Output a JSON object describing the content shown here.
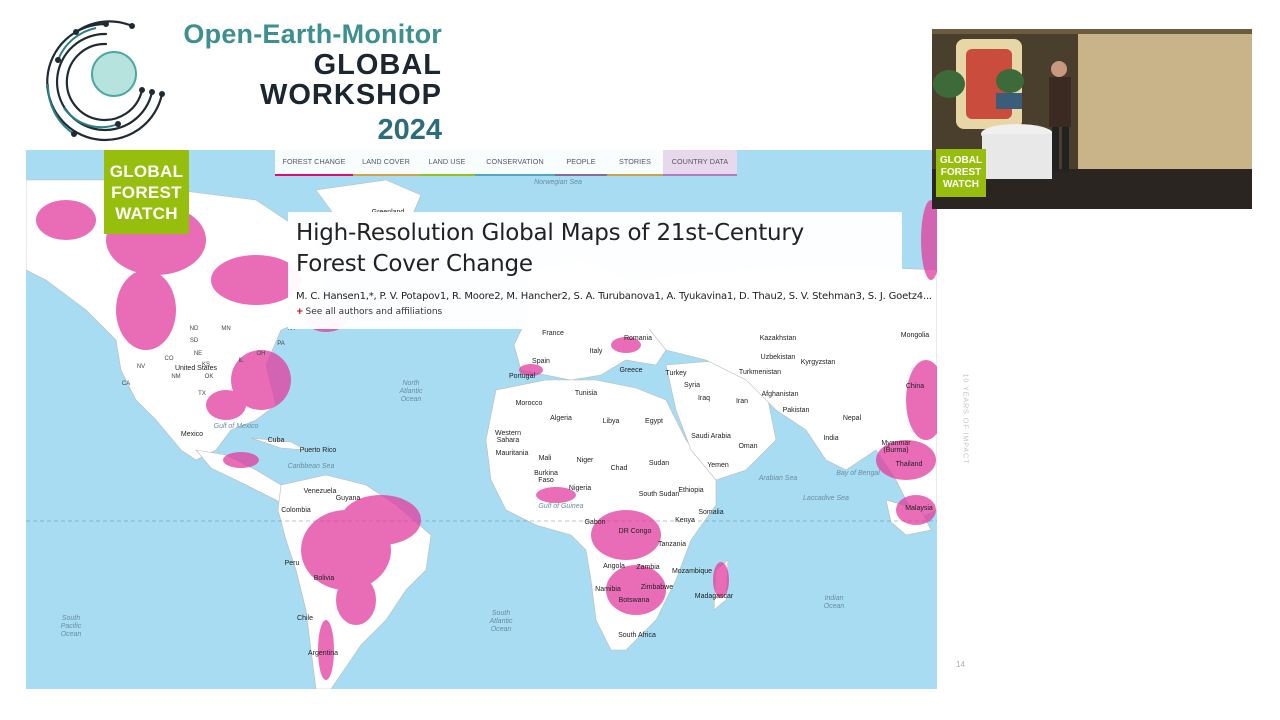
{
  "branding": {
    "line1": "Open-Earth-Monitor",
    "line2": "GLOBAL",
    "line3": "WORKSHOP",
    "year": "2024",
    "color_teal": "#3e8f8f",
    "color_dark": "#1b2630"
  },
  "slide": {
    "gfw_logo": [
      "GLOBAL",
      "FOREST",
      "WATCH"
    ],
    "nav": [
      "FOREST CHANGE",
      "LAND COVER",
      "LAND USE",
      "CONSERVATION",
      "PEOPLE",
      "STORIES",
      "COUNTRY DATA"
    ],
    "nav_colors": [
      "#e2097a",
      "#d1a545",
      "#98c21b",
      "#55a6c0",
      "#8a6a9a",
      "#c9a34a",
      "#b07bbf"
    ],
    "paper": {
      "title": "High-Resolution Global Maps of 21st-Century Forest Cover Change",
      "authors": "M. C. Hansen1,*, P. V. Potapov1, R. Moore2, M. Hancher2, S. A. Turubanova1, A. Tyukavina1, D. Thau2, S. V. Stehman3, S. J. Goetz4...",
      "affiliations": "See all authors and affiliations"
    },
    "map": {
      "ocean_color": "#a7dcf2",
      "land_color": "#ffffff",
      "forest_loss_color": "#e23c9f",
      "oceans": [
        "North Atlantic Ocean",
        "South Atlantic Ocean",
        "South Pacific Ocean",
        "Indian Ocean"
      ],
      "seas": [
        "Norwegian Sea",
        "Arabian Sea",
        "Bay of Bengal",
        "Gulf of Guinea",
        "Gulf of Mexico",
        "Caribbean Sea",
        "Laccadive Sea"
      ],
      "places": [
        "Greenland",
        "United States",
        "Mexico",
        "Cuba",
        "Puerto Rico",
        "Venezuela",
        "Colombia",
        "Guyana",
        "Peru",
        "Bolivia",
        "Chile",
        "Argentina",
        "Spain",
        "Portugal",
        "France",
        "Italy",
        "Greece",
        "Romania",
        "Turkey",
        "Iraq",
        "Syria",
        "Iran",
        "Saudi Arabia",
        "Oman",
        "Yemen",
        "Egypt",
        "Libya",
        "Algeria",
        "Morocco",
        "Tunisia",
        "Western Sahara",
        "Mauritania",
        "Mali",
        "Niger",
        "Chad",
        "Sudan",
        "South Sudan",
        "Ethiopia",
        "Somalia",
        "Kenya",
        "Tanzania",
        "Nigeria",
        "Burkina Faso",
        "Gabon",
        "DR Congo",
        "Angola",
        "Zambia",
        "Namibia",
        "Botswana",
        "Zimbabwe",
        "Mozambique",
        "Madagascar",
        "South Africa",
        "Kazakhstan",
        "Uzbekistan",
        "Kyrgyzstan",
        "Turkmenistan",
        "Afghanistan",
        "Pakistan",
        "Nepal",
        "India",
        "China",
        "Mongolia",
        "Myanmar (Burma)",
        "Thailand",
        "Malaysia"
      ],
      "us_states": [
        "NV",
        "CA",
        "ND",
        "SD",
        "NE",
        "KS",
        "OK",
        "TX",
        "NM",
        "CO",
        "MN",
        "IL",
        "OH",
        "PA",
        "NY"
      ]
    },
    "side_label": "10 YEARS OF IMPACT",
    "page_number": "14"
  },
  "video": {
    "gfw_logo": [
      "GLOBAL",
      "FOREST",
      "WATCH"
    ]
  }
}
